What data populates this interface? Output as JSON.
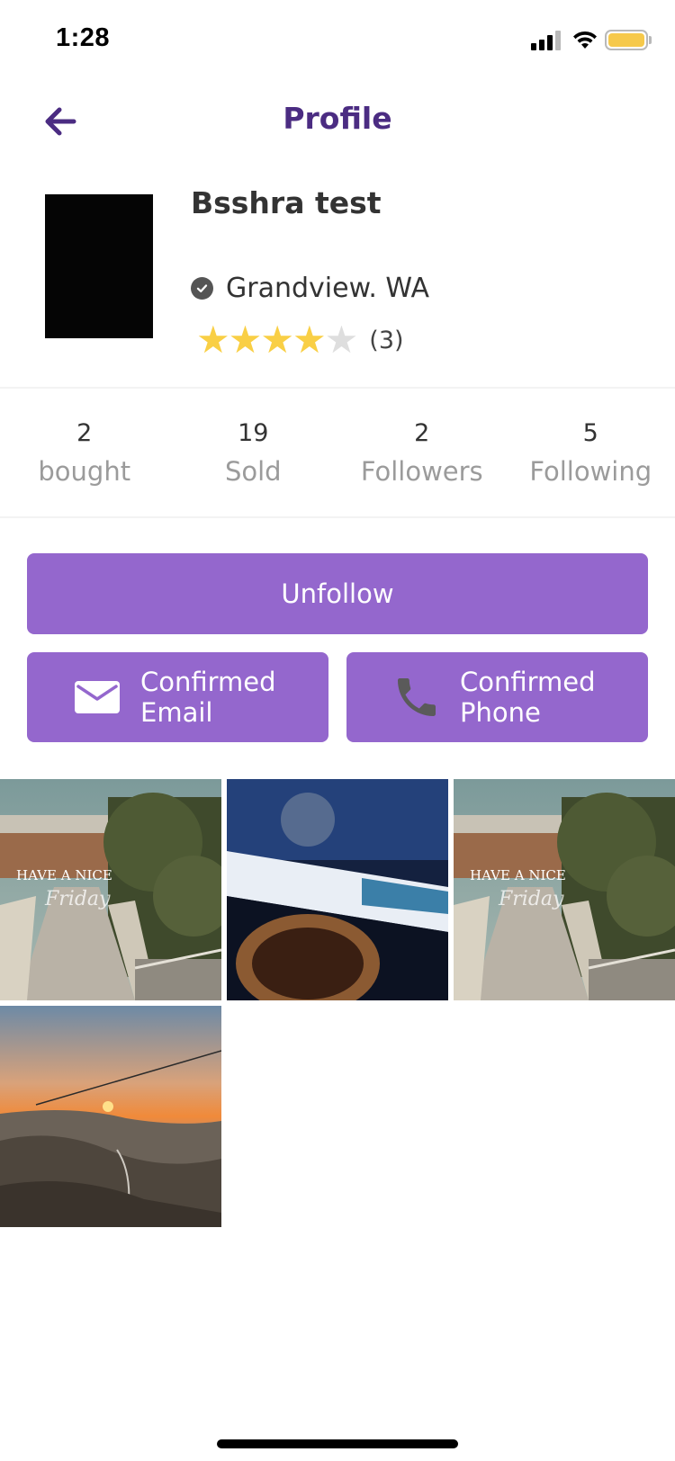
{
  "status_bar": {
    "time": "1:28"
  },
  "header": {
    "title": "Profile"
  },
  "profile": {
    "name": "Bsshra test",
    "location": "Grandview. WA",
    "rating": 4,
    "rating_max": 5,
    "rating_count": "(3)"
  },
  "stats": [
    {
      "value": "2",
      "label": "bought"
    },
    {
      "value": "19",
      "label": "Sold"
    },
    {
      "value": "2",
      "label": "Followers"
    },
    {
      "value": "5",
      "label": "Following"
    }
  ],
  "actions": {
    "unfollow_label": "Unfollow",
    "email": {
      "line1": "Confirmed",
      "line2": "Email"
    },
    "phone": {
      "line1": "Confirmed",
      "line2": "Phone"
    }
  },
  "gallery_text": {
    "tile1_line1": "HAVE A NICE",
    "tile1_line2": "Friday",
    "tile3_line1": "HAVE A NICE",
    "tile3_line2": "Friday"
  },
  "colors": {
    "accent": "#9467cd",
    "title": "#4b2c82",
    "star": "#f9cf45",
    "star_empty": "#dedede"
  }
}
